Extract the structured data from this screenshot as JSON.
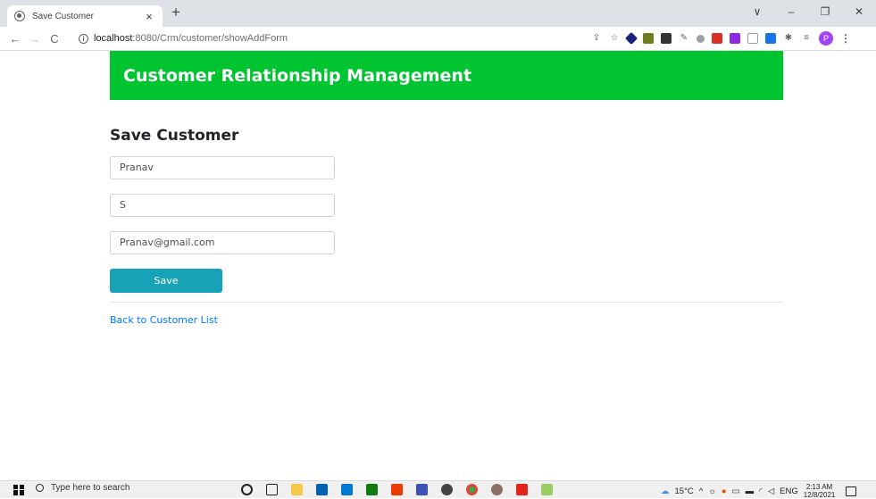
{
  "browser": {
    "tab_title": "Save Customer",
    "tab_close": "×",
    "new_tab": "+",
    "window_controls": {
      "collapse": "∨",
      "minimize": "–",
      "restore": "❐",
      "close": "✕"
    },
    "nav": {
      "back": "←",
      "forward": "→",
      "reload": "C"
    },
    "url_host": "localhost",
    "url_path": ":8080/Crm/customer/showAddForm",
    "profile_initial": "P"
  },
  "page": {
    "banner_title": "Customer Relationship Management",
    "form_title": "Save Customer",
    "first_name_value": "Pranav",
    "last_name_value": "S",
    "email_value": "Pranav@gmail.com",
    "save_label": "Save",
    "back_link": "Back to Customer List"
  },
  "taskbar": {
    "search_placeholder": "Type here to search",
    "weather": "15°C",
    "language": "ENG",
    "time": "2:13 AM",
    "date": "12/8/2021"
  },
  "colors": {
    "banner": "#00c531",
    "save_button": "#17a2b8",
    "link": "#007bff"
  }
}
